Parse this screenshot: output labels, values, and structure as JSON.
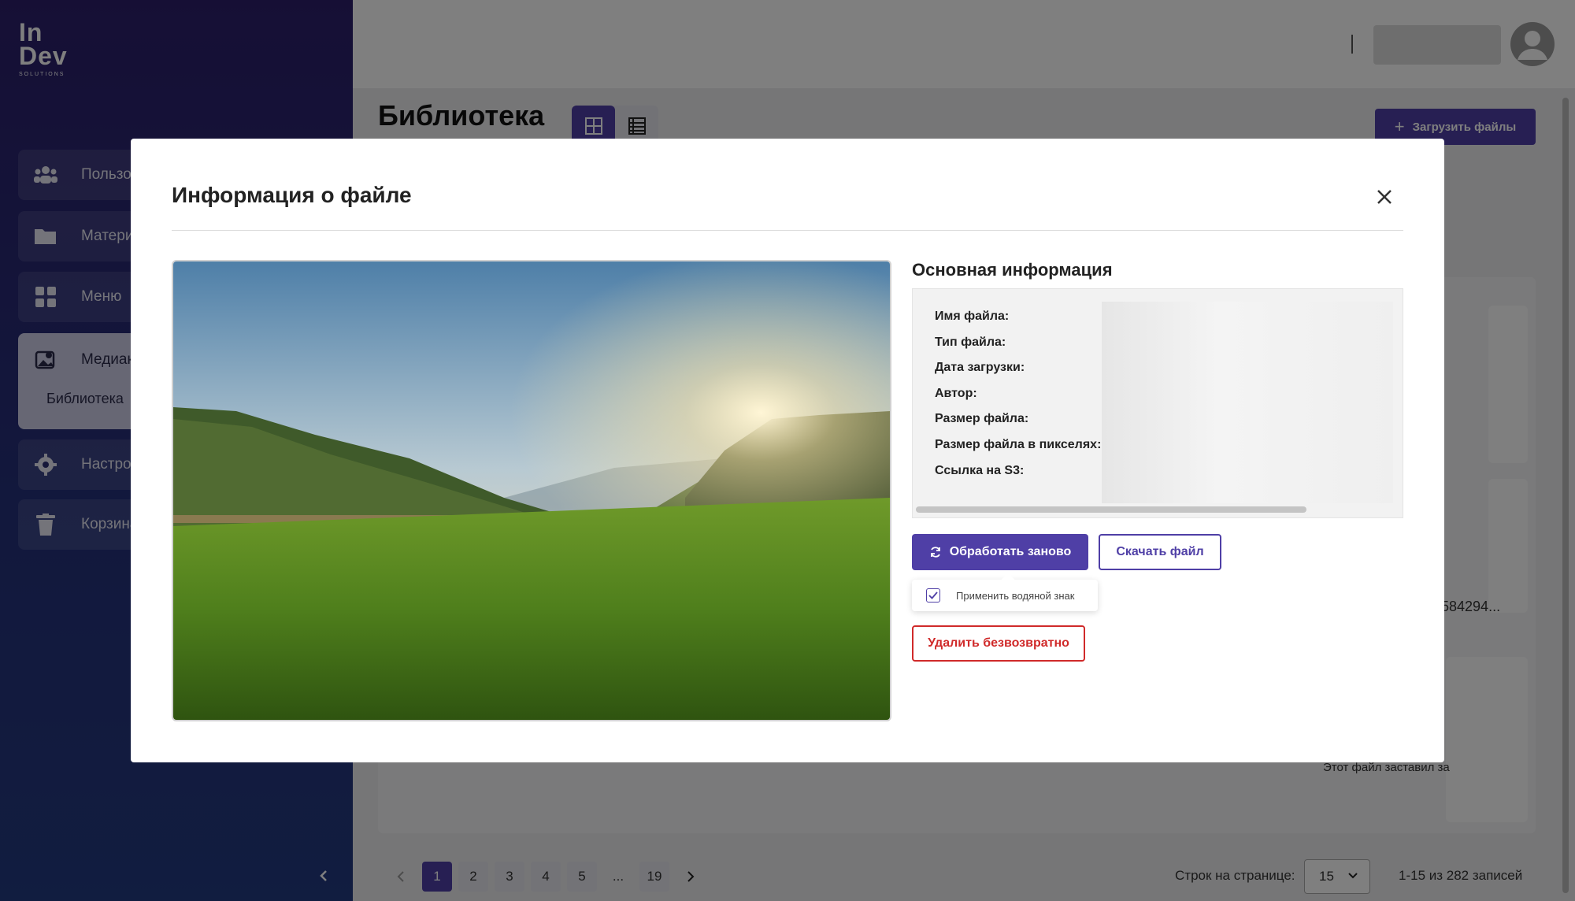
{
  "brand": {
    "logo_line1": "In",
    "logo_line2": "Dev",
    "logo_sub": "SOLUTIONS"
  },
  "sidebar": {
    "items": [
      {
        "label": "Пользова",
        "icon": "users-icon"
      },
      {
        "label": "Материа",
        "icon": "folder-icon"
      },
      {
        "label": "Меню",
        "icon": "grid-icon"
      },
      {
        "label": "Медиако",
        "icon": "media-icon",
        "subitem": "Библиотека"
      },
      {
        "label": "Настройк",
        "icon": "gear-icon"
      },
      {
        "label": "Корзина",
        "icon": "trash-icon"
      }
    ],
    "collapse_icon": "chevron-left-icon"
  },
  "page": {
    "title": "Библиотека",
    "upload_label": "Загрузить файлы",
    "bg_texts": [
      "584294...",
      "Этот файл заставил за"
    ]
  },
  "pagination": {
    "pages": [
      "1",
      "2",
      "3",
      "4",
      "5",
      "...",
      "19"
    ],
    "active": "1",
    "rows_label": "Строк на странице:",
    "rows_value": "15",
    "records": "1-15 из 282 записей"
  },
  "modal": {
    "title": "Информация о файле",
    "info_title": "Основная информация",
    "fields": [
      "Имя файла:",
      "Тип файла:",
      "Дата загрузки:",
      "Автор:",
      "Размер файла:",
      "Размер файла в пикселях:",
      "Ссылка на S3:"
    ],
    "reprocess_label": "Обработать заново",
    "download_label": "Скачать файл",
    "watermark_label": "Применить водяной знак",
    "watermark_checked": true,
    "delete_label": "Удалить безвозвратно"
  },
  "colors": {
    "accent": "#4f3fa6",
    "danger": "#d02a2a",
    "sidebar": "#2c1f6b"
  }
}
